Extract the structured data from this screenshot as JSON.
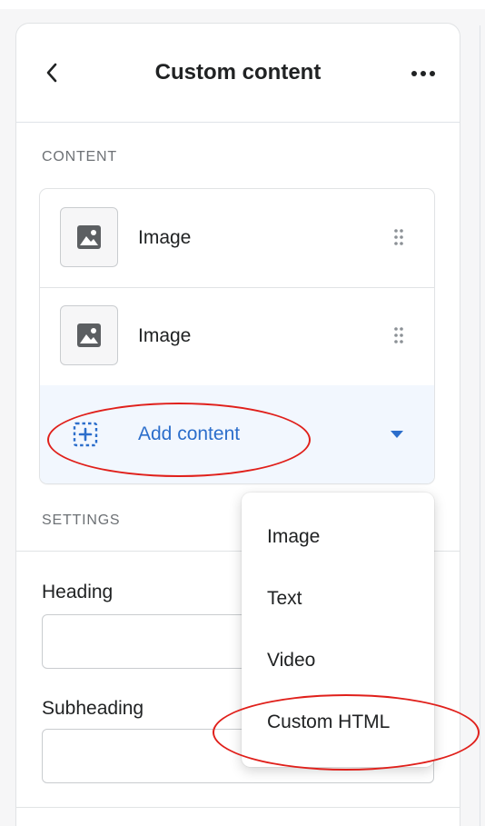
{
  "header": {
    "title": "Custom content",
    "back_icon": "chevron-left-icon",
    "more_icon": "horizontal-dots-icon"
  },
  "content_section": {
    "label": "CONTENT",
    "items": [
      {
        "label": "Image",
        "icon": "image-icon"
      },
      {
        "label": "Image",
        "icon": "image-icon"
      }
    ],
    "add_content": {
      "label": "Add content",
      "icon": "add-block-icon",
      "caret_icon": "caret-down-icon",
      "accent_color": "#2c6ecb"
    }
  },
  "settings_section": {
    "label": "SETTINGS",
    "fields": [
      {
        "label": "Heading",
        "value": ""
      },
      {
        "label": "Subheading",
        "value": ""
      }
    ]
  },
  "dropdown": {
    "options": [
      "Image",
      "Text",
      "Video",
      "Custom HTML"
    ]
  },
  "annotation_color": "#e0201b"
}
